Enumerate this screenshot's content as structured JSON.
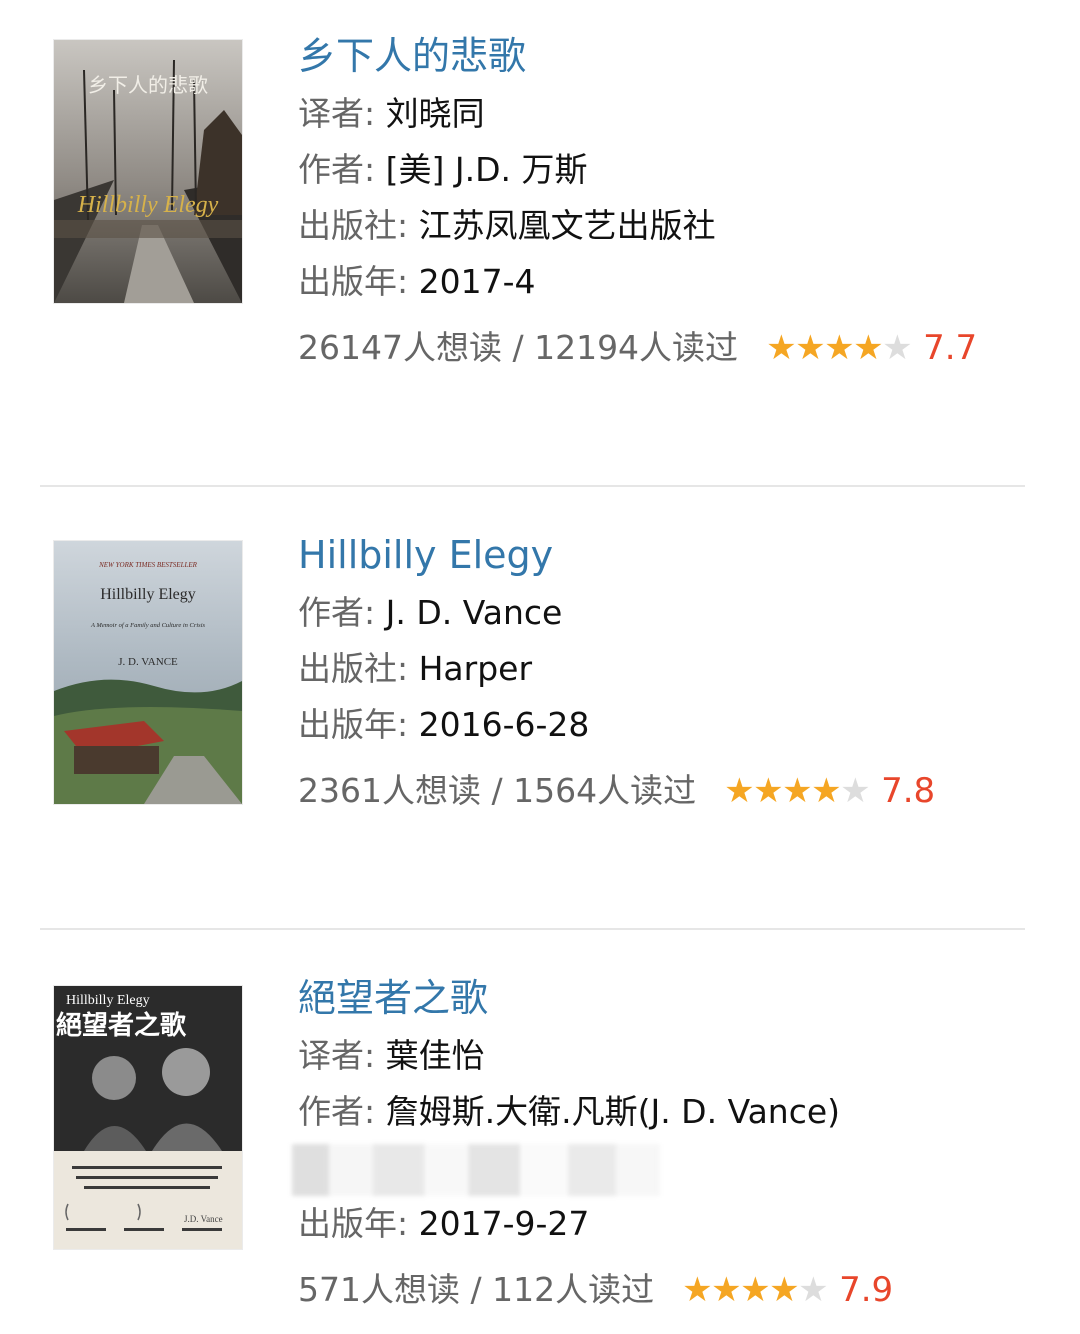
{
  "labels": {
    "translator": "译者: ",
    "author": "作者: ",
    "publisher": "出版社: ",
    "year": "出版年: "
  },
  "books": [
    {
      "title": "乡下人的悲歌",
      "translator": "刘晓同",
      "author": "[美] J.D. 万斯",
      "publisher": "江苏凤凰文艺出版社",
      "year": "2017-4",
      "counts": "26147人想读 / 12194人读过",
      "rating_stars": 4,
      "score": "7.7",
      "cover_text": [
        "乡下人的悲歌",
        "Hillbilly Elegy"
      ]
    },
    {
      "title": "Hillbilly Elegy",
      "author": "J. D. Vance",
      "publisher": "Harper",
      "year": "2016-6-28",
      "counts": "2361人想读 / 1564人读过",
      "rating_stars": 4,
      "score": "7.8",
      "cover_text": [
        "NEW YORK TIMES BESTSELLER",
        "Hillbilly Elegy",
        "A Memoir of a Family and Culture in Crisis",
        "J. D. VANCE"
      ]
    },
    {
      "title": "絕望者之歌",
      "translator": "葉佳怡",
      "author": "詹姆斯.大衛.凡斯(J. D. Vance)",
      "year": "2017-9-27",
      "counts": "571人想读 / 112人读过",
      "rating_stars": 4,
      "score": "7.9",
      "cover_text": [
        "Hillbilly Elegy",
        "絕望者之歌",
        "J.D. Vance"
      ]
    }
  ],
  "colors": {
    "title": "#3377aa",
    "star_on": "#f5a623",
    "star_off": "#dddddd",
    "score": "#e8462b",
    "label": "#666666"
  }
}
